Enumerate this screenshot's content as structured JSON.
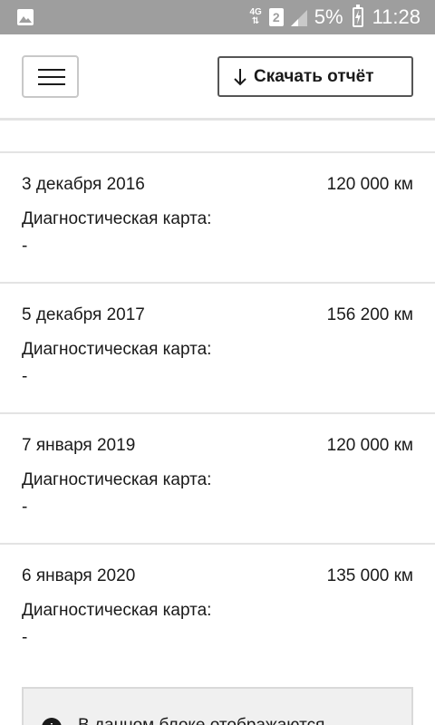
{
  "status_bar": {
    "network": "4G",
    "sim": "2",
    "battery": "5%",
    "time": "11:28"
  },
  "header": {
    "download_label": "Скачать отчёт"
  },
  "entries": [
    {
      "date": "3 декабря 2016",
      "mileage": "120 000 км",
      "label": "Диагностическая карта:",
      "value": "-"
    },
    {
      "date": "5 декабря 2017",
      "mileage": "156 200 км",
      "label": "Диагностическая карта:",
      "value": "-"
    },
    {
      "date": "7 января 2019",
      "mileage": "120 000 км",
      "label": "Диагностическая карта:",
      "value": "-"
    },
    {
      "date": "6 января 2020",
      "mileage": "135 000 км",
      "label": "Диагностическая карта:",
      "value": "-"
    }
  ],
  "info": {
    "text": "В данном блоке отображаются"
  },
  "colors": {
    "status_bar": "#9e9e9e",
    "divider": "#e3e3e3",
    "info_bg": "#f0f0f0"
  }
}
